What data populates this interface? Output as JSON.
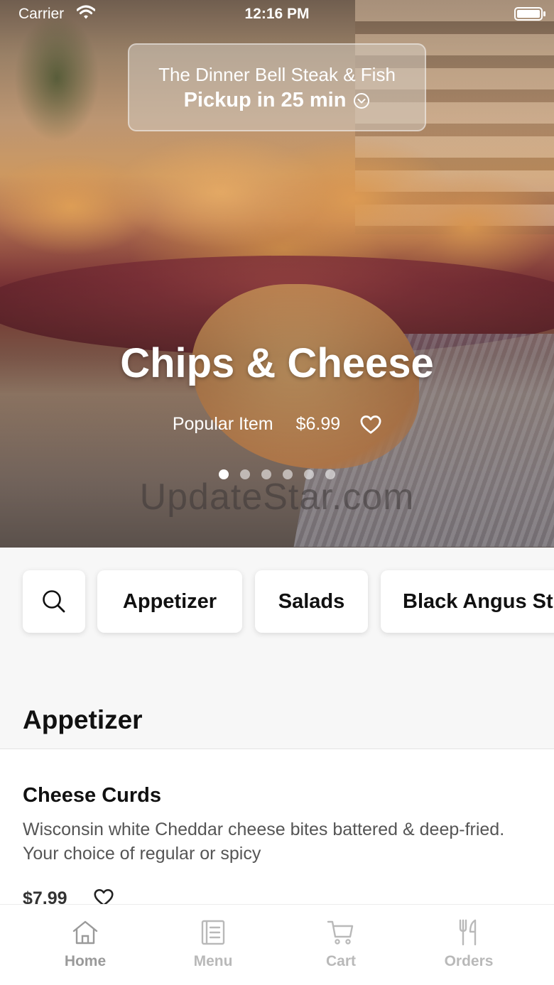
{
  "status_bar": {
    "carrier": "Carrier",
    "time": "12:16 PM"
  },
  "pickup": {
    "restaurant": "The Dinner Bell Steak & Fish",
    "eta": "Pickup in 25 min"
  },
  "hero": {
    "title": "Chips & Cheese",
    "tag": "Popular Item",
    "price": "$6.99",
    "carousel_pages": 6,
    "carousel_active": 1,
    "watermark": "UpdateStar.com"
  },
  "categories": [
    "Appetizer",
    "Salads",
    "Black Angus St"
  ],
  "section": {
    "title": "Appetizer"
  },
  "menu_item": {
    "name": "Cheese Curds",
    "description": "Wisconsin white Cheddar cheese bites battered & deep-fried. Your choice of regular or spicy",
    "price": "$7.99"
  },
  "tabs": [
    {
      "label": "Home",
      "icon": "home-icon"
    },
    {
      "label": "Menu",
      "icon": "menu-icon"
    },
    {
      "label": "Cart",
      "icon": "cart-icon"
    },
    {
      "label": "Orders",
      "icon": "utensils-icon"
    }
  ]
}
